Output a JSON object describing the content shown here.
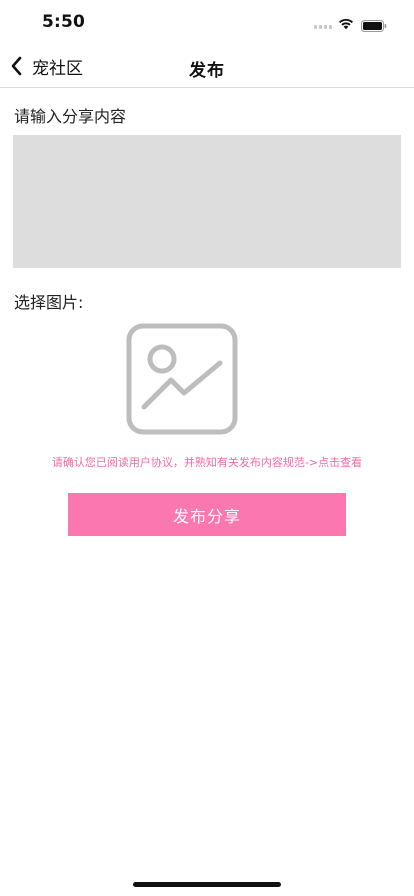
{
  "status_bar": {
    "time": "5:50",
    "icons": [
      "cellular-signal-icon",
      "wifi-icon",
      "battery-icon"
    ]
  },
  "nav": {
    "back_icon": "chevron-left-icon",
    "back_label": "宠社区",
    "title": "发布"
  },
  "form": {
    "content_label": "请输入分享内容",
    "content_value": "",
    "content_placeholder": "",
    "image_label": "选择图片:",
    "image_picker_icon": "image-placeholder-icon"
  },
  "agreement_text": "请确认您已阅读用户协议，并熟知有关发布内容规范->点击查看",
  "publish_button_label": "发布分享",
  "colors": {
    "accent": "#fa77b0",
    "agreement_text": "#f46aa6",
    "input_bg": "#dddddd",
    "icon_gray": "#bdbdbd"
  }
}
